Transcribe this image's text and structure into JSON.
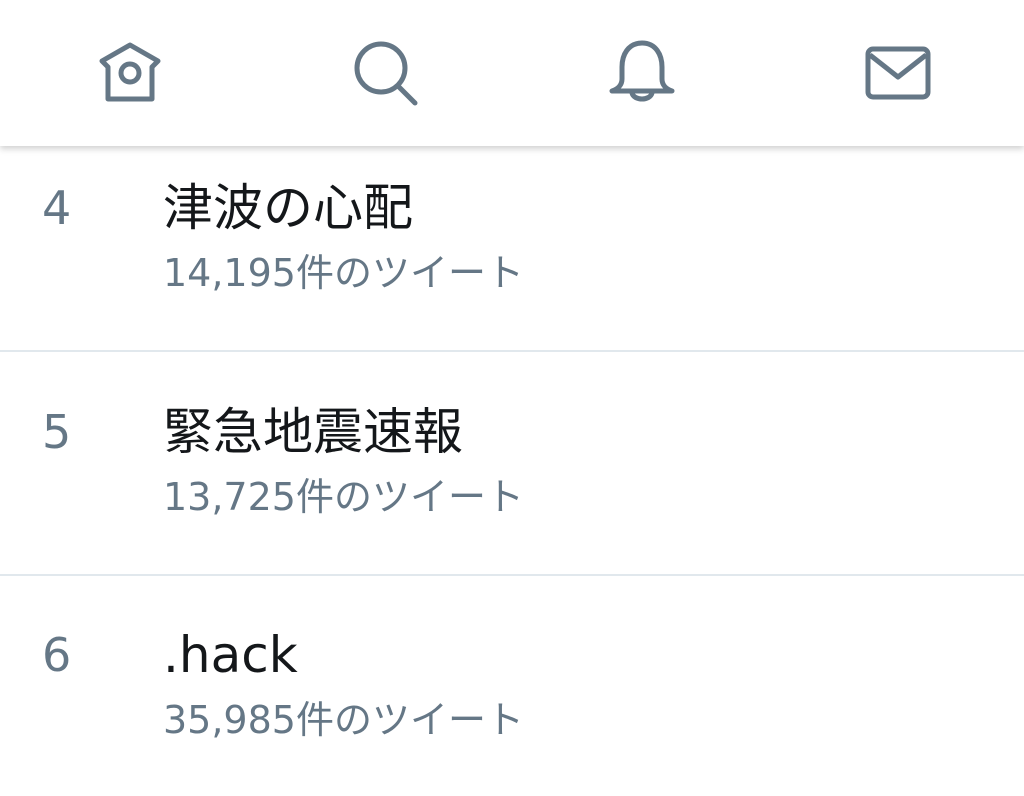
{
  "colors": {
    "icon": "#657786",
    "primary_text": "#14171a",
    "secondary_text": "#657786",
    "divider": "#e1e8ed"
  },
  "nav": {
    "items": [
      {
        "icon": "home-icon"
      },
      {
        "icon": "search-icon"
      },
      {
        "icon": "bell-icon"
      },
      {
        "icon": "mail-icon"
      }
    ]
  },
  "trends": [
    {
      "rank": "4",
      "title": "津波の心配",
      "count": "14,195件のツイート"
    },
    {
      "rank": "5",
      "title": "緊急地震速報",
      "count": "13,725件のツイート"
    },
    {
      "rank": "6",
      "title": ".hack",
      "count": "35,985件のツイート"
    }
  ]
}
